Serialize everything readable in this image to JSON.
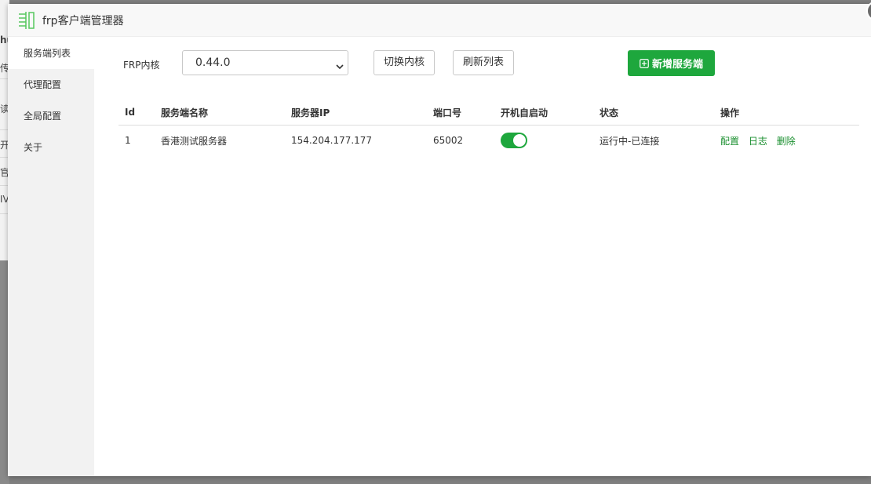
{
  "background_fragments": [
    "hu",
    "传",
    "读理",
    "开",
    "官",
    "IV"
  ],
  "window": {
    "title": "frp客户端管理器"
  },
  "sidebar": {
    "items": [
      {
        "label": "服务端列表",
        "active": true
      },
      {
        "label": "代理配置",
        "active": false
      },
      {
        "label": "全局配置",
        "active": false
      },
      {
        "label": "关于",
        "active": false
      }
    ]
  },
  "toolbar": {
    "core_label": "FRP内核",
    "core_version": "0.44.0",
    "switch_core_label": "切换内核",
    "refresh_label": "刷新列表",
    "add_server_label": "新增服务端"
  },
  "table": {
    "headers": [
      "Id",
      "服务端名称",
      "服务器IP",
      "端口号",
      "开机自启动",
      "状态",
      "操作"
    ],
    "rows": [
      {
        "id": "1",
        "name": "香港测试服务器",
        "ip": "154.204.177.177",
        "port": "65002",
        "autostart": true,
        "status": "运行中-已连接",
        "actions": [
          "配置",
          "日志",
          "删除"
        ]
      }
    ]
  },
  "colors": {
    "accent": "#1ea73d",
    "status_ok": "#1a8f2f"
  },
  "icons": [
    "logo-icon",
    "close-icon",
    "chevron-down-icon",
    "plus-square-icon"
  ]
}
